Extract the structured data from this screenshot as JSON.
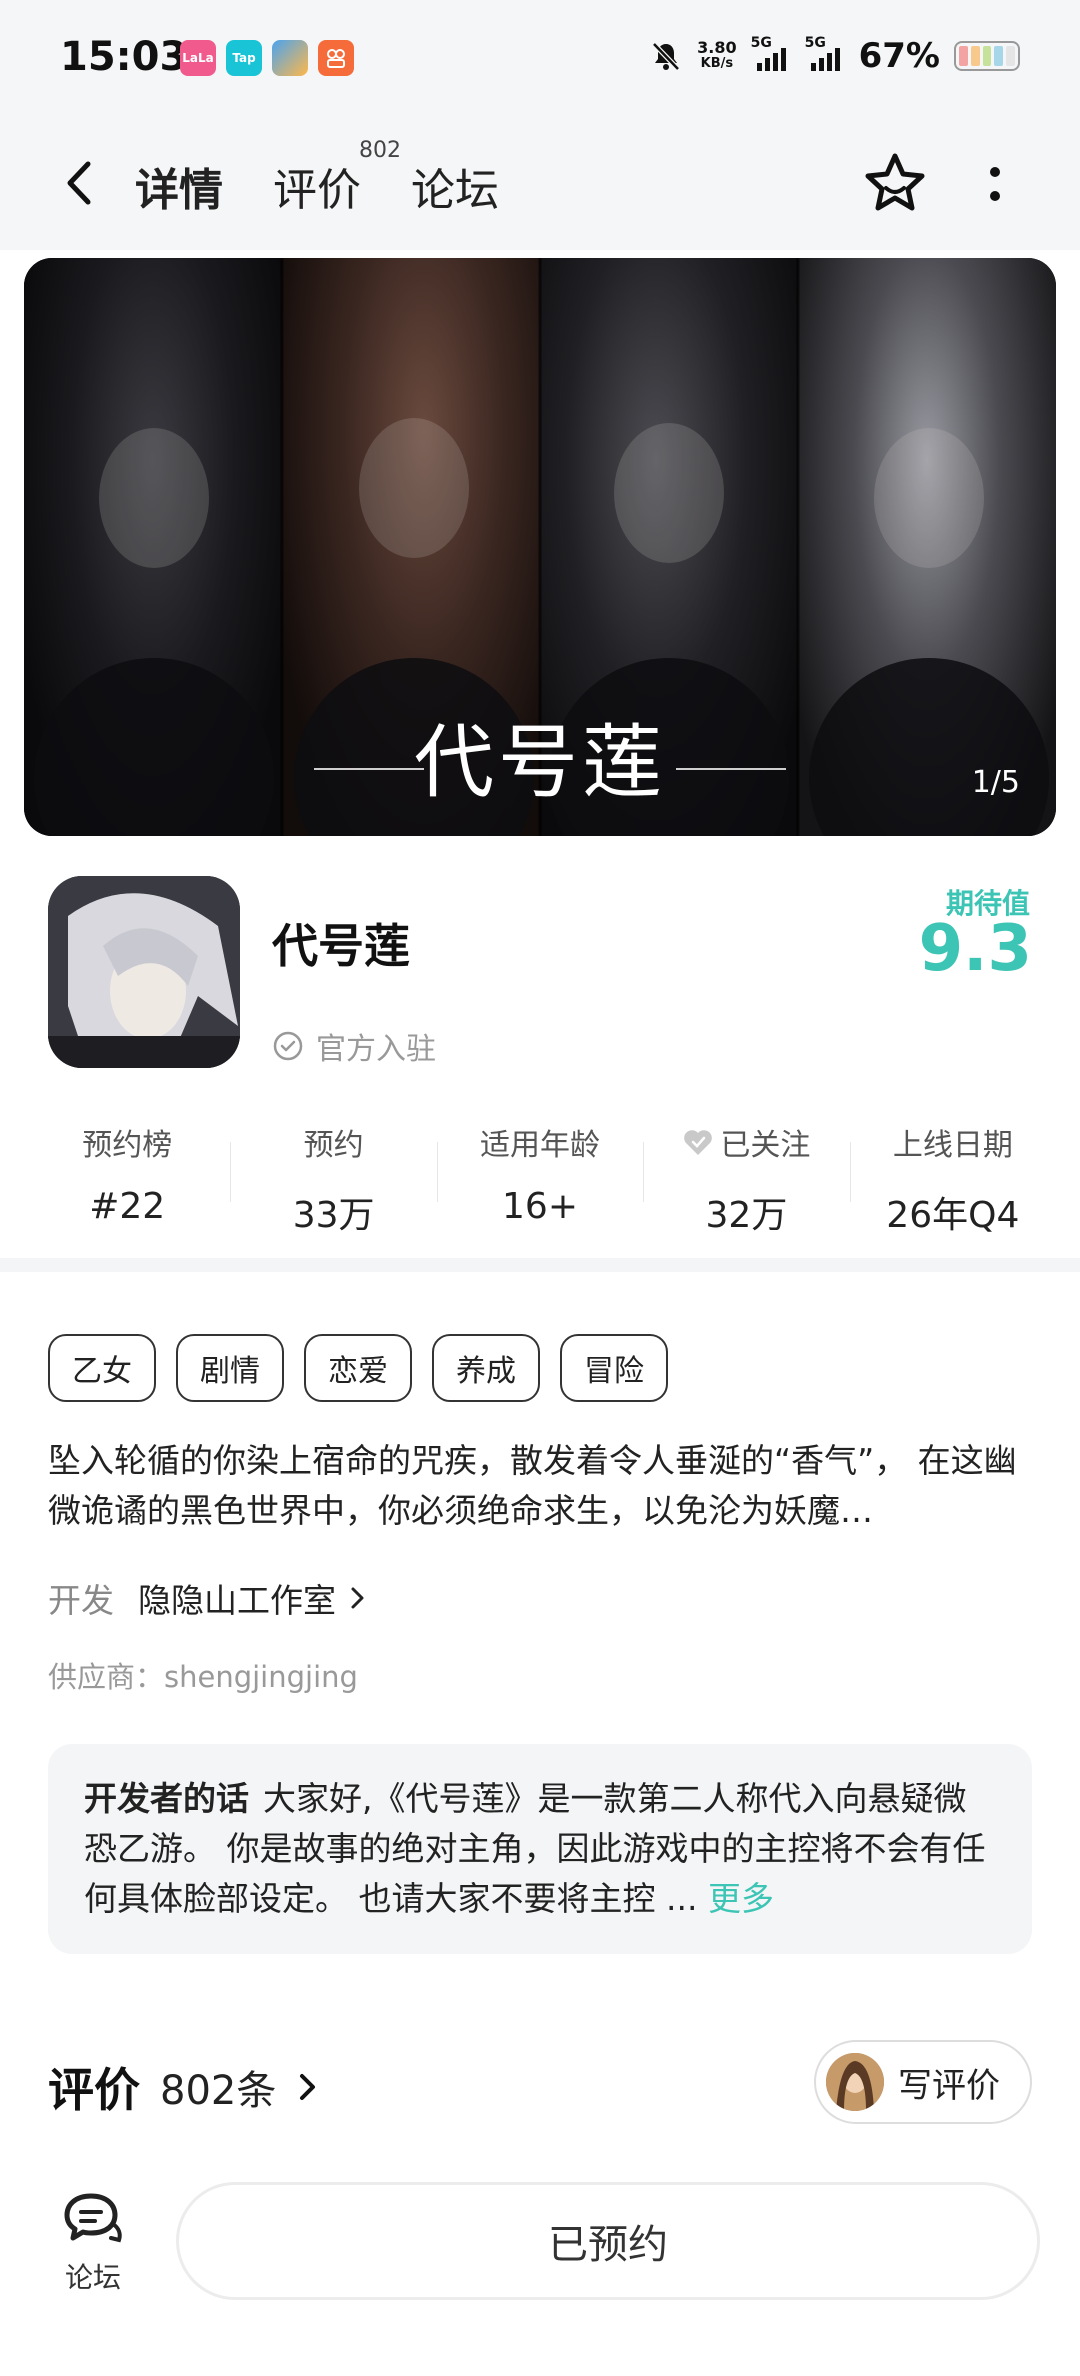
{
  "status_bar": {
    "time": "15:03",
    "app_badges": [
      {
        "name": "lala-app-icon",
        "text": "LaLa",
        "color": "#f05a8c"
      },
      {
        "name": "taptap-app-icon",
        "text": "Tap",
        "color": "#19c4d6"
      },
      {
        "name": "cloud-app-icon",
        "text": "",
        "color": "#4aa3f0"
      },
      {
        "name": "video-app-icon",
        "text": "",
        "color": "#f56b3a"
      }
    ],
    "net_speed": "3.80",
    "net_unit": "KB/s",
    "network_1": "5G",
    "network_2": "5G",
    "battery": "67%"
  },
  "header": {
    "tabs": [
      {
        "label": "详情",
        "active": true
      },
      {
        "label": "评价",
        "badge": "802"
      },
      {
        "label": "论坛"
      }
    ],
    "star_icon": "star-outline-icon",
    "more_icon": "more-vertical-icon"
  },
  "banner": {
    "title": "代号莲",
    "counter": "1/5"
  },
  "game": {
    "name": "代号莲",
    "official": "官方入驻",
    "expect_label": "期待值",
    "expect_value": "9.3"
  },
  "stats": [
    {
      "label": "预约榜",
      "value": "#22"
    },
    {
      "label": "预约",
      "value": "33万"
    },
    {
      "label": "适用年龄",
      "value": "16+"
    },
    {
      "label": "已关注",
      "value": "32万",
      "icon": "heart-icon"
    },
    {
      "label": "上线日期",
      "value": "26年Q4"
    }
  ],
  "tags": [
    "乙女",
    "剧情",
    "恋爱",
    "养成",
    "冒险"
  ],
  "description": "坠入轮循的你染上宿命的咒疾，散发着令人垂涎的“香气”， 在这幽微诡谲的黑色世界中，你必须绝命求生，以免沦为妖魔…",
  "developer": {
    "label": "开发",
    "name": "隐隐山工作室"
  },
  "supplier": "供应商：shengjingjing",
  "dev_note": {
    "title": "开发者的话",
    "text": "大家好,《代号莲》是一款第二人称代入向悬疑微恐乙游。 你是故事的绝对主角，因此游戏中的主控将不会有任何具体脸部设定。 也请大家不要将主控 ...",
    "more": "更多"
  },
  "reviews": {
    "title": "评价",
    "count": "802条",
    "write": "写评价"
  },
  "bottom": {
    "forum_label": "论坛",
    "reserved": "已预约"
  },
  "colors": {
    "accent": "#3cc4b5",
    "tab_underline": "#5fd3c6"
  }
}
